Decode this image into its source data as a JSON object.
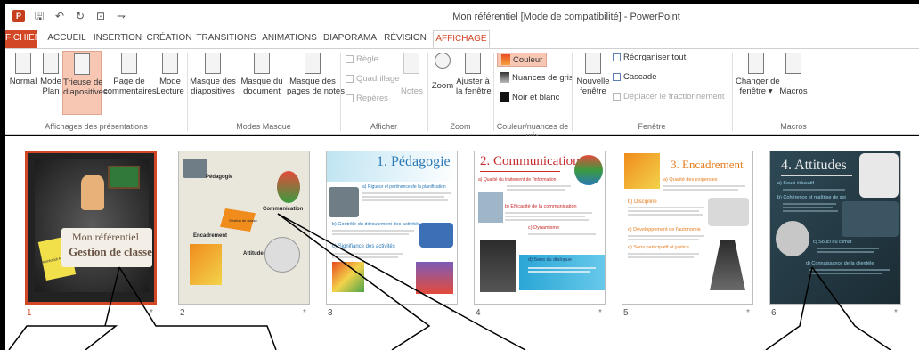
{
  "title_bar": {
    "window_title": "Mon référentiel [Mode de compatibilité] - PowerPoint",
    "app_icon": "P"
  },
  "tabs": [
    "FICHIER",
    "ACCUEIL",
    "INSERTION",
    "CRÉATION",
    "TRANSITIONS",
    "ANIMATIONS",
    "DIAPORAMA",
    "RÉVISION",
    "AFFICHAGE"
  ],
  "ribbon": {
    "normal": "Normal",
    "plan": "Mode\nPlan",
    "trieuse": "Trieuse de\ndiapositives",
    "page_commentaires": "Page de\ncommentaires",
    "mode_lecture": "Mode\nLecture",
    "masque_diapositives": "Masque des\ndiapositives",
    "masque_document": "Masque du\ndocument",
    "masque_notes": "Masque des\npages de notes",
    "regle": "Règle",
    "quadrillage": "Quadrillage",
    "reperes": "Repères",
    "notes": "Notes",
    "zoom": "Zoom",
    "ajuster": "Ajuster à\nla fenêtre",
    "couleur": "Couleur",
    "nuances": "Nuances de gris",
    "noir_blanc": "Noir et blanc",
    "nouvelle_fenetre": "Nouvelle\nfenêtre",
    "reorganiser": "Réorganiser tout",
    "cascade": "Cascade",
    "deplacer": "Déplacer le fractionnement",
    "changer_fenetre": "Changer de\nfenêtre ▾",
    "macros": "Macros",
    "groups": {
      "affichages": "Affichages des présentations",
      "modes_masque": "Modes Masque",
      "afficher": "Afficher",
      "zoom": "Zoom",
      "couleur": "Couleur/nuances de gris",
      "fenetre": "Fenêtre",
      "macros": "Macros"
    }
  },
  "slides": [
    {
      "number": "1",
      "title": "Mon référentiel",
      "subtitle": "Gestion de classe",
      "small": "Par: Monkaddi Asadkoul"
    },
    {
      "number": "2",
      "t1": "Pédagogie",
      "t2": "Communication",
      "t3": "Gestion de classe",
      "t4": "Encadrement",
      "t5": "Attitudes"
    },
    {
      "number": "3",
      "title": "1. Pédagogie",
      "h1": "a) Rigueur et pertinence de la planification",
      "h2": "b) Contrôle du déroulement des activités",
      "h3": "c) Signifiance des activités"
    },
    {
      "number": "4",
      "title": "2. Communication",
      "h1": "a) Qualité du traitement de l'information",
      "h2": "b) Efficacité de la communication",
      "h3": "c) Dynamisme",
      "h4": "d) Sens du dialogue"
    },
    {
      "number": "5",
      "title": "3. Encadrement",
      "h1": "a) Qualité des exigences",
      "h2": "b) Discipline",
      "h3": "c) Développement de l'autonomie",
      "h4": "d) Sens participatif et justice"
    },
    {
      "number": "6",
      "title": "4. Attitudes",
      "h1": "a) Souci éducatif",
      "h2": "b) Cohérence et maîtrise de soi",
      "h3": "c) Souci du climat",
      "h4": "d) Connaissance de la clientèle"
    }
  ],
  "star": "*"
}
